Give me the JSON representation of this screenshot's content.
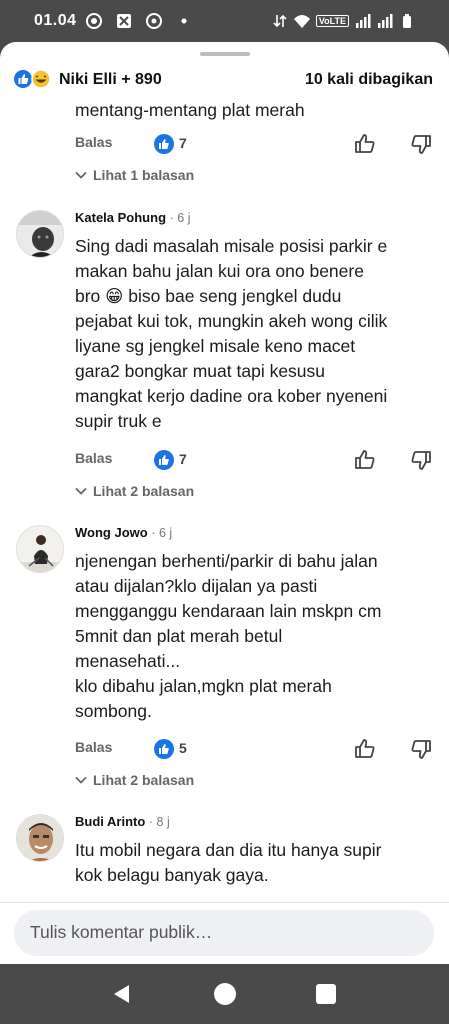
{
  "status_bar": {
    "time": "01.04",
    "volte": "VoLTE",
    "icons": [
      "focus-icon",
      "screen-record-icon",
      "chrome-icon",
      "dot-icon",
      "data-transfer-icon",
      "wifi-icon",
      "signal-icon",
      "signal-icon",
      "battery-icon"
    ]
  },
  "header": {
    "reactions": [
      "like-icon",
      "haha-icon"
    ],
    "reactors": "Niki Elli + 890",
    "shares": "10 kali dibagikan"
  },
  "comments": [
    {
      "author": "",
      "time": "",
      "lines": [
        "mentang-mentang plat merah"
      ],
      "reply_label": "Balas",
      "likes": "7",
      "replies_label": "Lihat 1 balasan"
    },
    {
      "author": "Katela Pohung",
      "time": "· 6 j",
      "lines": [
        "Sing dadi masalah misale posisi parkir e",
        "makan bahu jalan kui ora ono benere",
        "bro 😁 biso bae seng jengkel dudu",
        "pejabat kui tok, mungkin akeh wong cilik",
        "liyane sg jengkel misale keno macet",
        "gara2 bongkar muat tapi kesusu",
        "mangkat kerjo dadine ora kober nyeneni",
        "supir truk e"
      ],
      "reply_label": "Balas",
      "likes": "7",
      "replies_label": "Lihat 2 balasan"
    },
    {
      "author": "Wong Jowo",
      "time": "· 6 j",
      "lines": [
        "njenengan berhenti/parkir di bahu jalan",
        "atau dijalan?klo dijalan ya pasti",
        "mengganggu kendaraan lain mskpn cm",
        "5mnit dan plat merah betul",
        "menasehati...",
        "klo dibahu jalan,mgkn plat merah",
        "sombong."
      ],
      "reply_label": "Balas",
      "likes": "5",
      "replies_label": "Lihat 2 balasan"
    },
    {
      "author": "Budi Arinto",
      "time": "· 8 j",
      "lines": [
        "Itu mobil negara dan dia itu hanya supir",
        "kok belagu banyak gaya."
      ]
    }
  ],
  "composer": {
    "placeholder": "Tulis komentar publik…"
  },
  "colors": {
    "accent": "#1b74e4",
    "system_bar": "#4a4a4a",
    "composer_bg": "#eef0f3"
  }
}
